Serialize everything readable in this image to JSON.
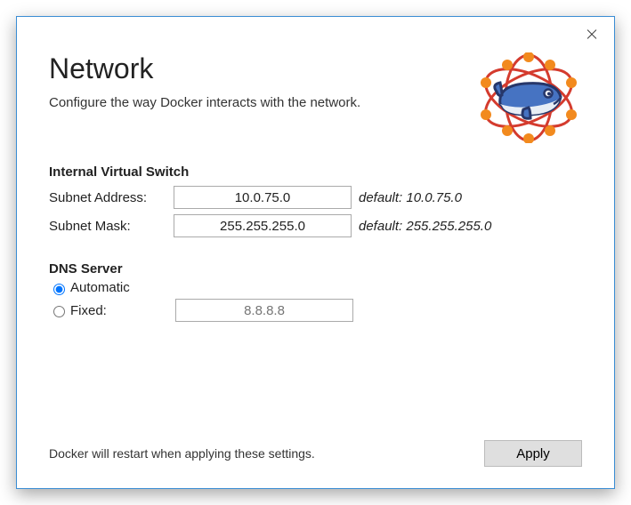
{
  "title": "Network",
  "subtitle": "Configure the way Docker interacts with the network.",
  "sections": {
    "switch": {
      "heading": "Internal Virtual Switch",
      "subnet_address": {
        "label": "Subnet Address:",
        "value": "10.0.75.0",
        "default_note": "default: 10.0.75.0"
      },
      "subnet_mask": {
        "label": "Subnet Mask:",
        "value": "255.255.255.0",
        "default_note": "default: 255.255.255.0"
      }
    },
    "dns": {
      "heading": "DNS Server",
      "automatic": {
        "label": "Automatic",
        "checked": true
      },
      "fixed": {
        "label": "Fixed:",
        "checked": false,
        "placeholder": "8.8.8.8"
      }
    }
  },
  "footer": {
    "note": "Docker will restart when applying these settings.",
    "apply_label": "Apply"
  }
}
